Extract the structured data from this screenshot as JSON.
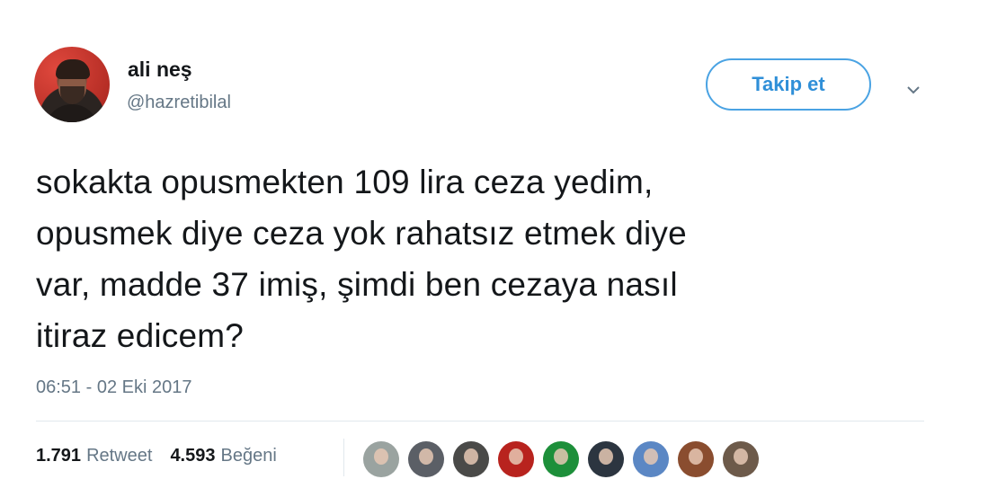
{
  "user": {
    "display_name": "ali neş",
    "handle": "@hazretibilal"
  },
  "follow_button": {
    "label": "Takip et"
  },
  "menu": {
    "icon": "chevron-down-icon"
  },
  "tweet": {
    "text": "sokakta opusmekten 109 lira ceza yedim,\nopusmek diye ceza yok rahatsız etmek diye\nvar, madde 37 imiş, şimdi ben cezaya nasıl\nitiraz edicem?",
    "timestamp": "06:51 - 02 Eki 2017"
  },
  "stats": {
    "retweets_count": "1.791",
    "retweets_label": "Retweet",
    "likes_count": "4.593",
    "likes_label": "Beğeni"
  },
  "likers": [
    {
      "color": "#9aa3a0"
    },
    {
      "color": "#5b5f66"
    },
    {
      "color": "#4a4a48"
    },
    {
      "color": "#b8231e"
    },
    {
      "color": "#1d8f3a"
    },
    {
      "color": "#2c3540"
    },
    {
      "color": "#5b87c4"
    },
    {
      "color": "#8a4d2f"
    },
    {
      "color": "#6d5a4a"
    }
  ],
  "colors": {
    "accent": "#4aa3e3",
    "secondary_text": "#657786",
    "primary_text": "#14171a"
  }
}
